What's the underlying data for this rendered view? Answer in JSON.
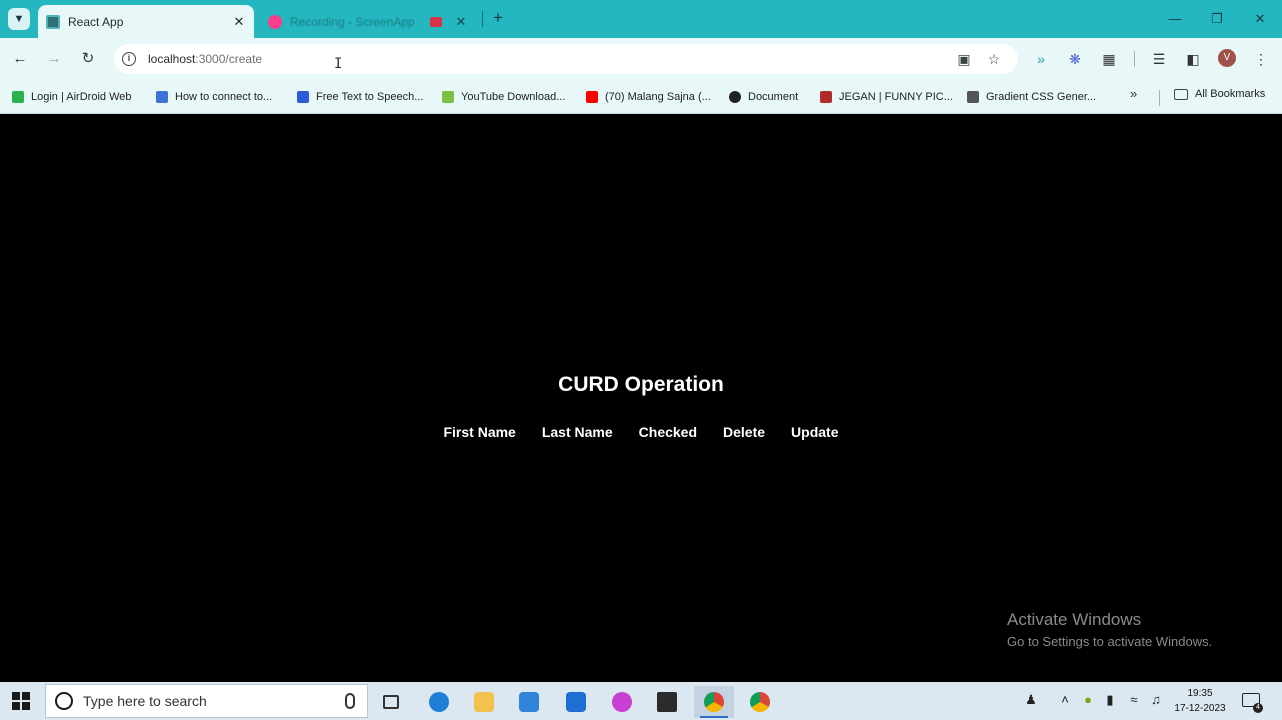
{
  "browser": {
    "tabs": [
      {
        "title": "React App",
        "active": true
      },
      {
        "title": "Recording - ScreenApp",
        "active": false
      }
    ],
    "url_host": "localhost",
    "url_path": ":3000/create",
    "bookmarks": [
      {
        "label": "Login | AirDroid Web",
        "color": "#2bb24c"
      },
      {
        "label": "How to connect to...",
        "color": "#3c73d6"
      },
      {
        "label": "Free Text to Speech...",
        "color": "#2c5bd8"
      },
      {
        "label": "YouTube Download...",
        "color": "#7bc043"
      },
      {
        "label": "(70) Malang Sajna (...",
        "color": "#ff0000"
      },
      {
        "label": "Document",
        "color": "#222222"
      },
      {
        "label": "JEGAN | FUNNY PIC...",
        "color": "#b22a2a"
      },
      {
        "label": "Gradient CSS Gener...",
        "color": "#555555"
      }
    ],
    "all_bookmarks_label": "All Bookmarks",
    "profile_initial": "V"
  },
  "page": {
    "heading": "CURD Operation",
    "columns": [
      "First Name",
      "Last Name",
      "Checked",
      "Delete",
      "Update"
    ]
  },
  "watermark": {
    "line1": "Activate Windows",
    "line2": "Go to Settings to activate Windows."
  },
  "taskbar": {
    "search_placeholder": "Type here to search",
    "time": "19:35",
    "date": "17-12-2023",
    "notification_count": "4",
    "apps": [
      {
        "name": "task-view",
        "color": "#333333"
      },
      {
        "name": "edge",
        "color": "#1f7fd6"
      },
      {
        "name": "file-explorer",
        "color": "#f2c14e"
      },
      {
        "name": "store",
        "color": "#2f83d9"
      },
      {
        "name": "mail",
        "color": "#1e6fd1"
      },
      {
        "name": "brave-like",
        "color": "#c93fd1"
      },
      {
        "name": "terminal",
        "color": "#2b2b2b"
      },
      {
        "name": "chrome",
        "color": "#db4437"
      },
      {
        "name": "chrome-2",
        "color": "#db4437"
      }
    ]
  }
}
